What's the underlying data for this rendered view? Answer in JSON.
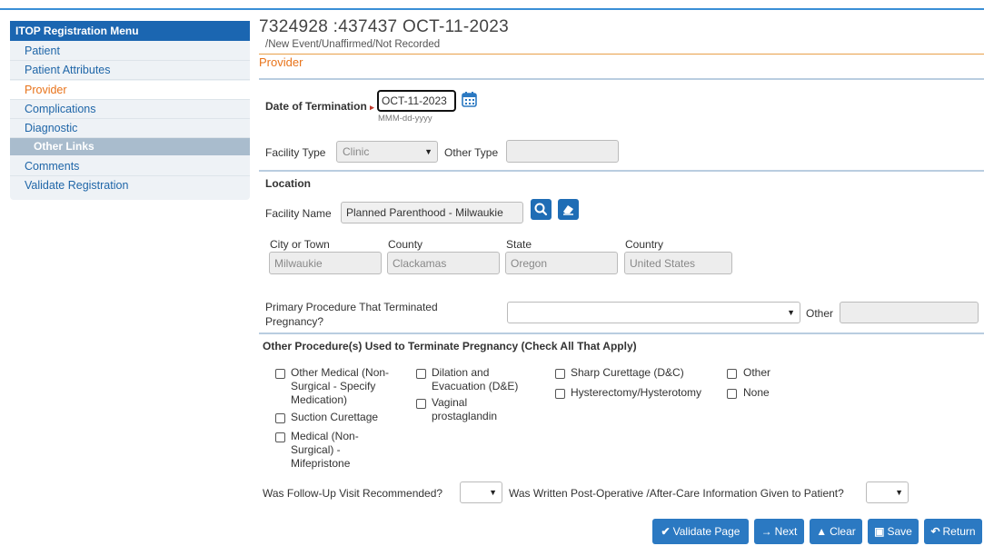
{
  "sidebar": {
    "title": "ITOP Registration Menu",
    "items": [
      {
        "label": "Patient"
      },
      {
        "label": "Patient Attributes"
      },
      {
        "label": "Provider"
      },
      {
        "label": "Complications"
      },
      {
        "label": "Diagnostic"
      },
      {
        "label": "Other Links"
      },
      {
        "label": "Comments"
      },
      {
        "label": "Validate Registration"
      }
    ]
  },
  "header": {
    "title": "7324928   :437437  OCT-11-2023",
    "subtitle": "/New Event/Unaffirmed/Not Recorded",
    "section": "Provider"
  },
  "form": {
    "termination_label": "Date of Termination",
    "termination_value": "OCT-11-2023",
    "date_format": "MMM-dd-yyyy",
    "facility_type_label": "Facility Type",
    "facility_type_value": "Clinic",
    "other_type_label": "Other Type",
    "other_type_value": "",
    "location_label": "Location",
    "facility_name_label": "Facility Name",
    "facility_name_value": "Planned Parenthood - Milwaukie",
    "city_label": "City or Town",
    "city_value": "Milwaukie",
    "county_label": "County",
    "county_value": "Clackamas",
    "state_label": "State",
    "state_value": "Oregon",
    "country_label": "Country",
    "country_value": "United States",
    "primary_proc_label_1": "Primary Procedure That Terminated",
    "primary_proc_label_2": "Pregnancy?",
    "primary_proc_value": "",
    "other_label": "Other",
    "other_value": "",
    "other_procs_label": "Other Procedure(s) Used to Terminate Pregnancy (Check All That Apply)",
    "proc_options": {
      "other_medical": [
        "Other Medical (Non-",
        "Surgical - Specify",
        "Medication)"
      ],
      "suction": "Suction Curettage",
      "mifepristone": [
        "Medical (Non-",
        "Surgical) -",
        "Mifepristone"
      ],
      "dne": [
        "Dilation and",
        "Evacuation (D&E)"
      ],
      "vaginal": [
        "Vaginal",
        "prostaglandin"
      ],
      "sharp": "Sharp Curettage (D&C)",
      "hysterectomy": "Hysterectomy/Hysterotomy",
      "other": "Other",
      "none": "None"
    },
    "followup_label": "Was Follow-Up Visit Recommended?",
    "followup_value": "",
    "postop_label": "Was Written Post-Operative /After-Care Information Given to Patient?",
    "postop_value": ""
  },
  "actions": {
    "validate": "Validate Page",
    "next": "Next",
    "clear": "Clear",
    "save": "Save",
    "return": "Return"
  },
  "colors": {
    "primary": "#1f6db5",
    "accent": "#e8731a",
    "sidebar_header": "#1b66b1"
  }
}
